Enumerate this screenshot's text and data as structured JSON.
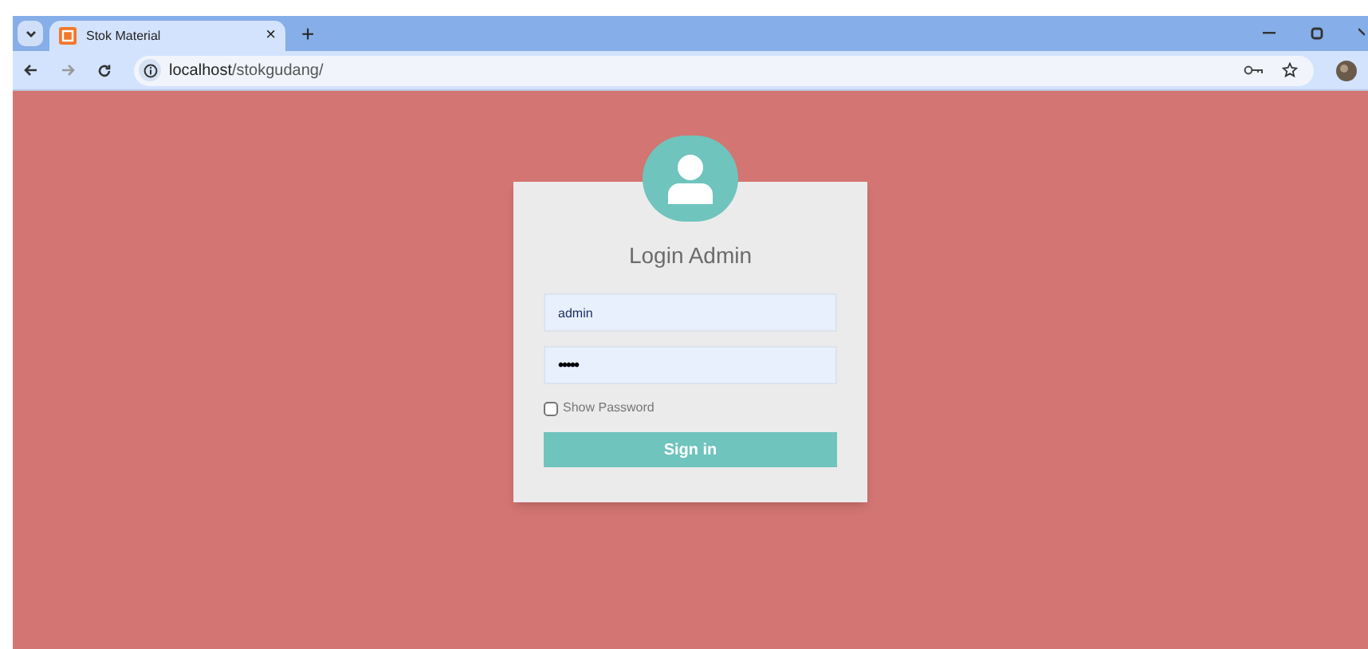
{
  "browser": {
    "tabs": [
      {
        "title": "Stok Material",
        "selected": true,
        "close": "×"
      }
    ],
    "new_tab": "+",
    "address": {
      "host": "localhost",
      "path": "/stokgudang/"
    }
  },
  "login": {
    "title": "Login Admin",
    "fields": [
      {
        "kind": "text",
        "value": "admin"
      },
      {
        "kind": "password",
        "value": "•••••"
      }
    ],
    "show_password": {
      "label": "Show Password",
      "checked": false
    },
    "button": "Sign in"
  }
}
